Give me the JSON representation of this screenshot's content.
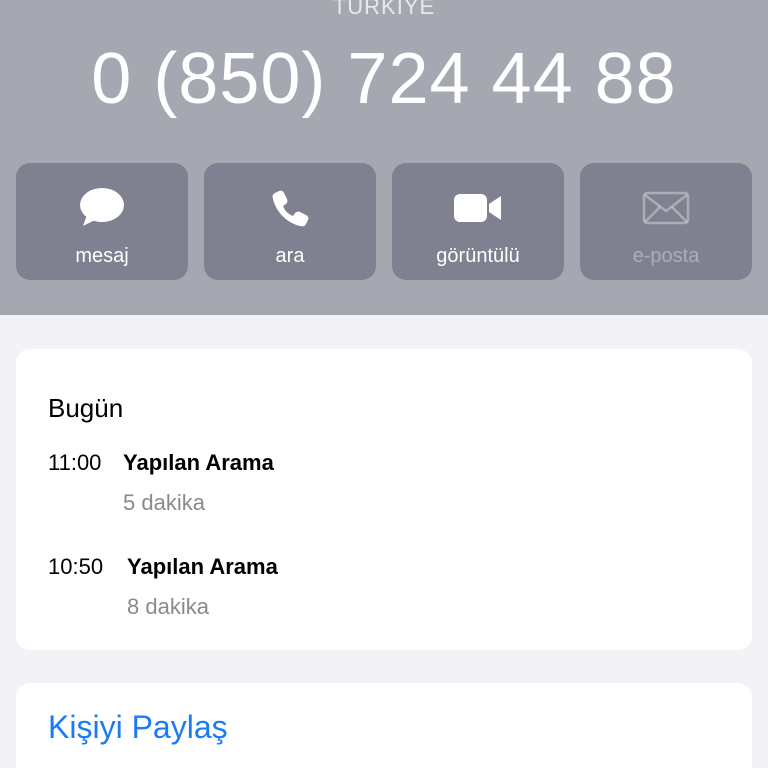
{
  "header": {
    "country": "TÜRKİYE",
    "phone_number": "0 (850) 724 44 88"
  },
  "actions": [
    {
      "label": "mesaj",
      "icon": "message-bubble-icon",
      "enabled": true
    },
    {
      "label": "ara",
      "icon": "phone-icon",
      "enabled": true
    },
    {
      "label": "görüntülü",
      "icon": "video-camera-icon",
      "enabled": true
    },
    {
      "label": "e-posta",
      "icon": "envelope-icon",
      "enabled": false
    }
  ],
  "history": {
    "day": "Bugün",
    "entries": [
      {
        "time": "11:00",
        "type": "Yapılan Arama",
        "duration": "5 dakika"
      },
      {
        "time": "10:50",
        "type": "Yapılan Arama",
        "duration": "8 dakika"
      }
    ]
  },
  "share": {
    "label": "Kişiyi Paylaş"
  },
  "colors": {
    "header_bg": "#a5a7b1",
    "button_bg": "#7f8190",
    "page_bg": "#f2f2f7",
    "link": "#1a7cf5",
    "secondary_text": "#8a8a8e"
  }
}
